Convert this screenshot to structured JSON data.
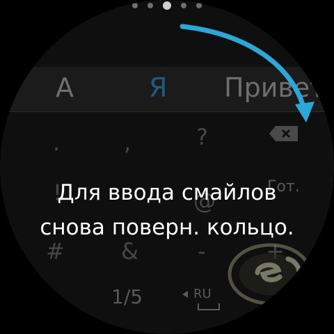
{
  "pager": {
    "count": 5,
    "active_index": 2
  },
  "suggestions": [
    "А",
    "Я",
    "Привет"
  ],
  "keys": {
    "row1": [
      ".",
      ",",
      "?"
    ],
    "row2": [
      "!",
      "@"
    ],
    "row3": [
      "#",
      "&",
      "-",
      "+"
    ],
    "page_indicator": "1/5",
    "language": "RU",
    "done": "Гот."
  },
  "hint": {
    "line1": "Для ввода смайлов",
    "line2": "снова поверн. кольцо."
  },
  "colors": {
    "accent": "#2aa8d8",
    "hint_text": "#ffffff",
    "dim_key": "#474747"
  },
  "icons": {
    "backspace": "backspace-icon",
    "gesture": "curved-arrow-icon"
  }
}
